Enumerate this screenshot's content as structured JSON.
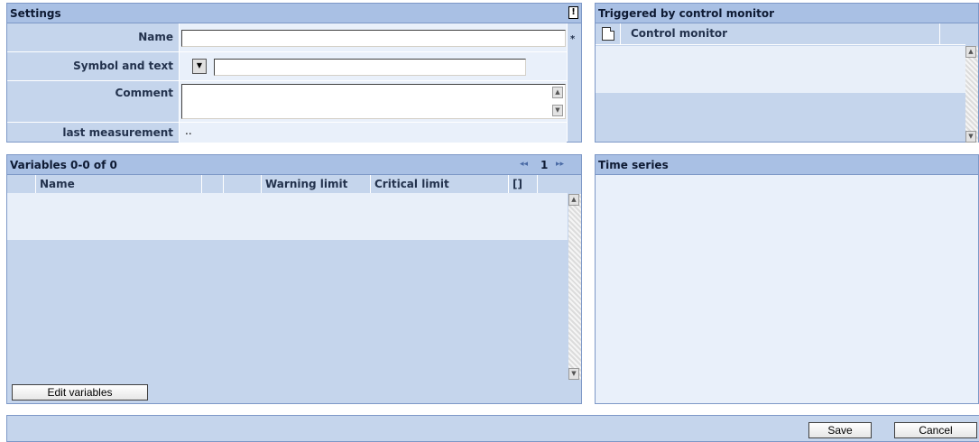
{
  "settings": {
    "title": "Settings",
    "info_glyph": "!",
    "name_label": "Name",
    "name_value": "",
    "required_mark": "*",
    "symbol_label": "Symbol and text",
    "symbol_value": "",
    "comment_label": "Comment",
    "comment_value": "",
    "last_measurement_label": "last measurement",
    "last_measurement_value": ".."
  },
  "triggered": {
    "title": "Triggered by control monitor",
    "column_control_monitor": "Control monitor"
  },
  "variables": {
    "title": "Variables 0-0 of 0",
    "pager_first": "◂◂",
    "page": "1",
    "pager_last": "▸▸",
    "columns": [
      "Name",
      "",
      "",
      "Warning limit",
      "Critical limit",
      "[]"
    ],
    "edit_button": "Edit variables"
  },
  "timeseries": {
    "title": "Time series"
  },
  "footer": {
    "save_label": "Save",
    "cancel_label": "Cancel"
  },
  "icons": {
    "dropdown": "dropdown-arrow-icon",
    "document": "document-icon",
    "scroll_up": "scroll-up-icon",
    "scroll_down": "scroll-down-icon"
  },
  "colors": {
    "panel_title_bg": "#a9c0e4",
    "panel_bg": "#c5d5ec",
    "row_light": "#e8eff9",
    "border": "#7d98c7"
  }
}
